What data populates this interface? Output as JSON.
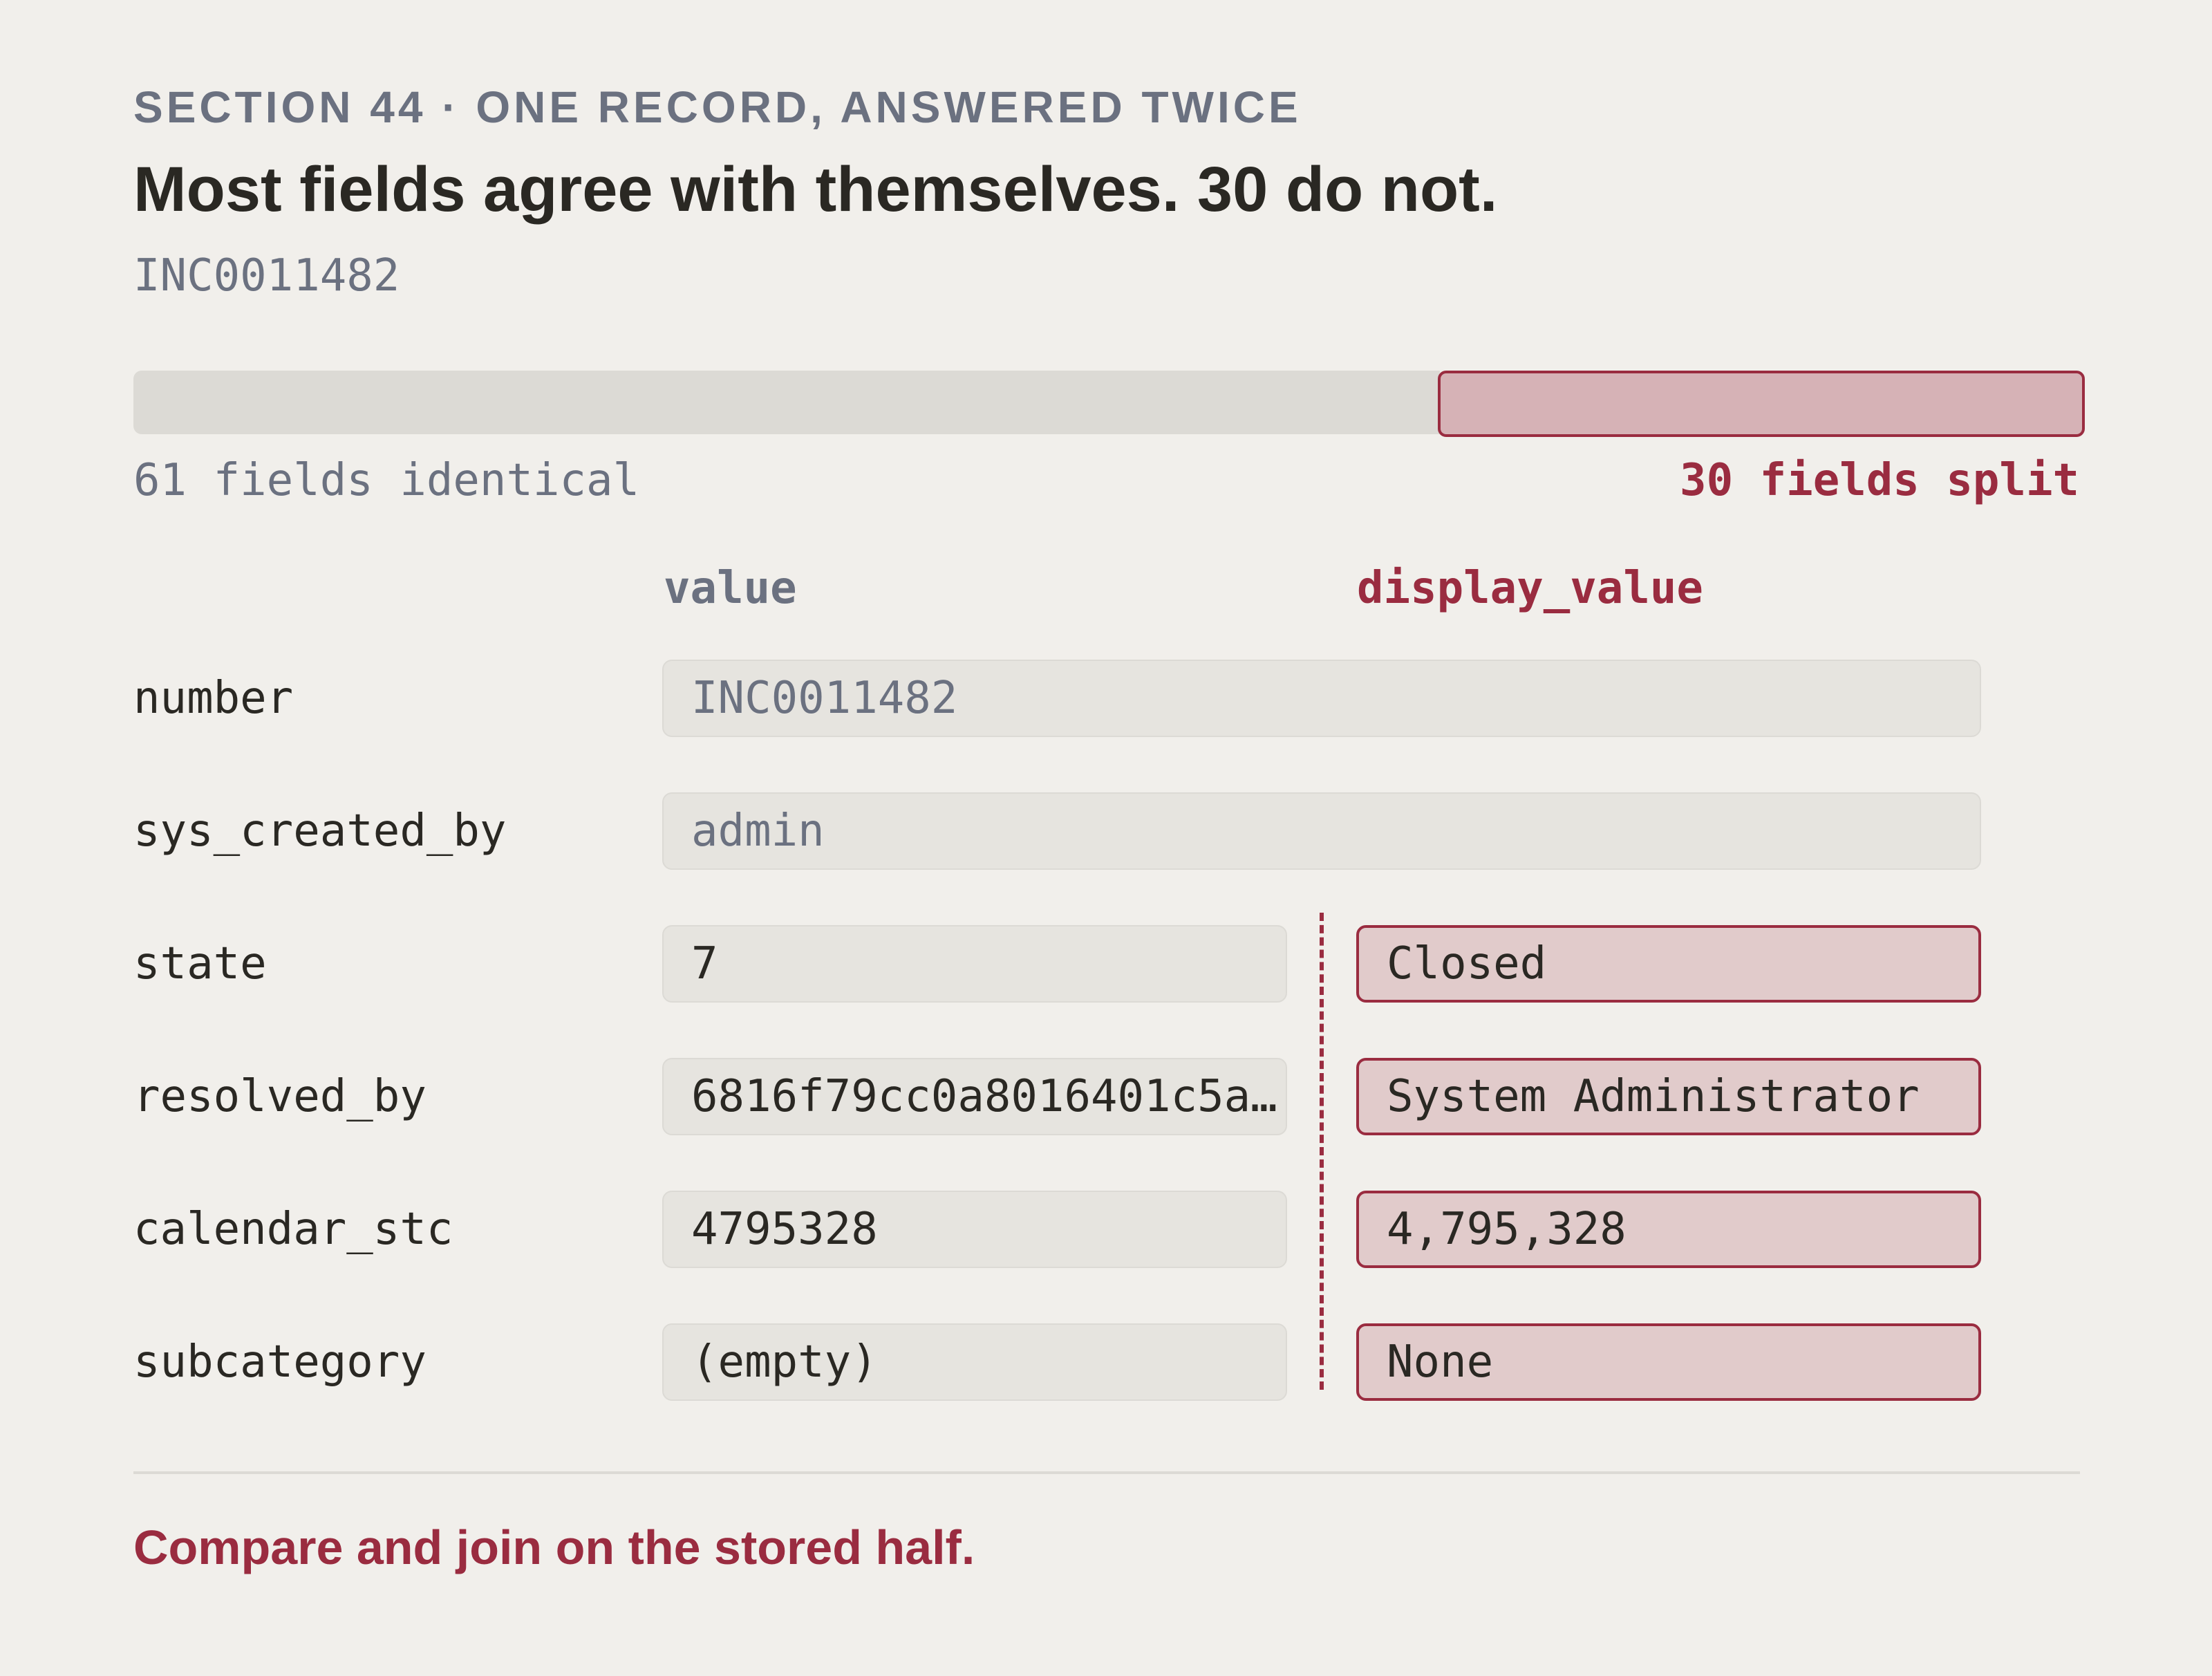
{
  "header": {
    "eyebrow": "SECTION 44 · ONE RECORD, ANSWERED TWICE",
    "headline": "Most fields agree with themselves. 30 do not.",
    "record_id": "INC0011482"
  },
  "split_bar": {
    "identical_count": 61,
    "split_count": 30,
    "identical_label": "61 fields identical",
    "split_label": "30 fields split"
  },
  "columns": {
    "value_header": "value",
    "display_header": "display_value"
  },
  "rows": [
    {
      "field": "number",
      "value": "INC0011482",
      "display_value": "INC0011482",
      "split": false
    },
    {
      "field": "sys_created_by",
      "value": "admin",
      "display_value": "admin",
      "split": false
    },
    {
      "field": "state",
      "value": "7",
      "display_value": "Closed",
      "split": true
    },
    {
      "field": "resolved_by",
      "value": "6816f79cc0a8016401c5a…",
      "display_value": "System Administrator",
      "split": true
    },
    {
      "field": "calendar_stc",
      "value": "4795328",
      "display_value": "4,795,328",
      "split": true
    },
    {
      "field": "subcategory",
      "value": "(empty)",
      "display_value": "None",
      "split": true
    }
  ],
  "footer": {
    "takeaway": "Compare and join on the stored half."
  },
  "colors": {
    "accent": "#9a2c40",
    "muted": "#6b7180",
    "background": "#f1efeb"
  }
}
